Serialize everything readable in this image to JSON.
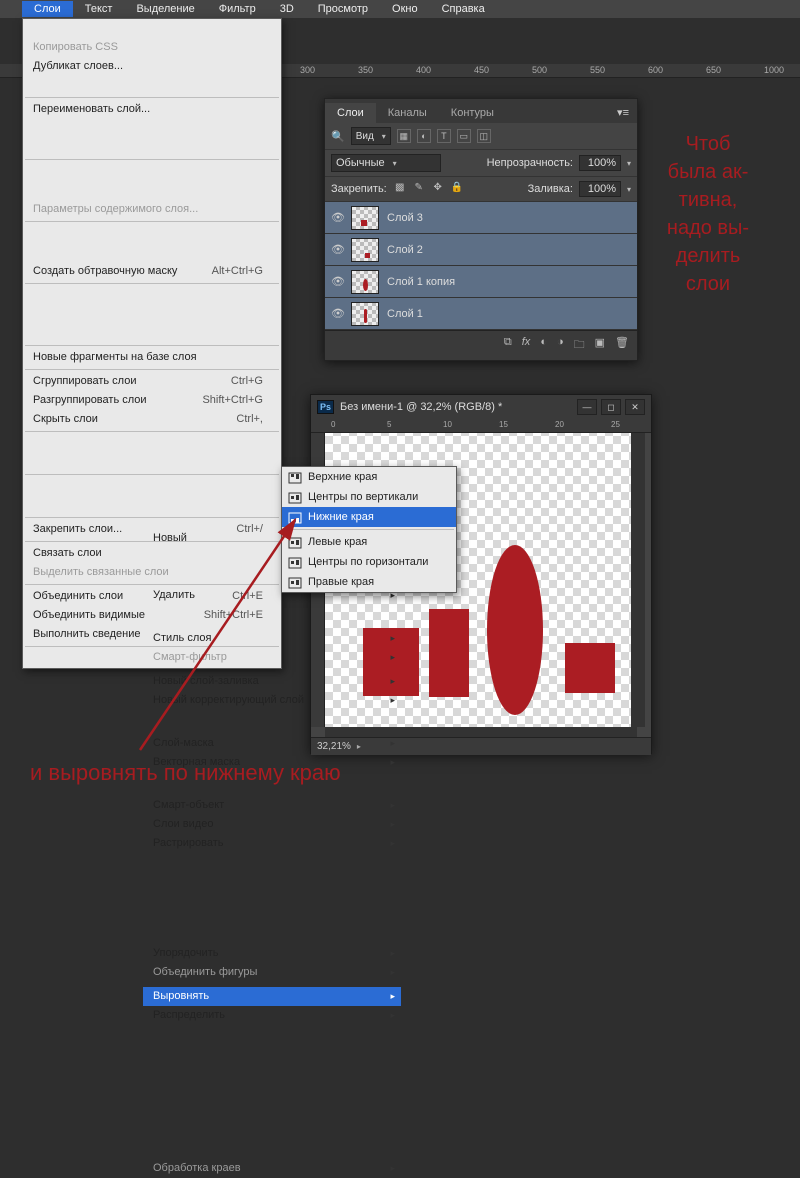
{
  "menubar": {
    "items": [
      "Слои",
      "Текст",
      "Выделение",
      "Фильтр",
      "3D",
      "Просмотр",
      "Окно",
      "Справка"
    ],
    "open_index": 0
  },
  "dropdown": [
    {
      "t": "item",
      "label": "Новый",
      "arrow": true
    },
    {
      "t": "item",
      "label": "Копировать CSS",
      "disabled": true
    },
    {
      "t": "item",
      "label": "Дубликат слоев..."
    },
    {
      "t": "item",
      "label": "Удалить",
      "arrow": true
    },
    {
      "t": "sep"
    },
    {
      "t": "item",
      "label": "Переименовать слой..."
    },
    {
      "t": "item",
      "label": "Стиль слоя",
      "arrow": true
    },
    {
      "t": "item",
      "label": "Смарт-фильтр",
      "disabled": true,
      "arrow": true
    },
    {
      "t": "sep"
    },
    {
      "t": "item",
      "label": "Новый слой-заливка",
      "arrow": true
    },
    {
      "t": "item",
      "label": "Новый корректирующий слой",
      "arrow": true
    },
    {
      "t": "item",
      "label": "Параметры содержимого слоя...",
      "disabled": true
    },
    {
      "t": "sep"
    },
    {
      "t": "item",
      "label": "Слой-маска",
      "arrow": true
    },
    {
      "t": "item",
      "label": "Векторная маска",
      "arrow": true
    },
    {
      "t": "item",
      "label": "Создать обтравочную маску",
      "shortcut": "Alt+Ctrl+G"
    },
    {
      "t": "sep"
    },
    {
      "t": "item",
      "label": "Смарт-объект",
      "arrow": true
    },
    {
      "t": "item",
      "label": "Слои видео",
      "arrow": true
    },
    {
      "t": "item",
      "label": "Растрировать",
      "arrow": true
    },
    {
      "t": "sep"
    },
    {
      "t": "item",
      "label": "Новые фрагменты на базе слоя"
    },
    {
      "t": "sep"
    },
    {
      "t": "item",
      "label": "Сгруппировать слои",
      "shortcut": "Ctrl+G"
    },
    {
      "t": "item",
      "label": "Разгруппировать слои",
      "shortcut": "Shift+Ctrl+G"
    },
    {
      "t": "item",
      "label": "Скрыть слои",
      "shortcut": "Ctrl+,"
    },
    {
      "t": "sep"
    },
    {
      "t": "item",
      "label": "Упорядочить",
      "arrow": true
    },
    {
      "t": "item",
      "label": "Объединить фигуры",
      "disabled": true,
      "arrow": true
    },
    {
      "t": "sep"
    },
    {
      "t": "item",
      "label": "Выровнять",
      "arrow": true,
      "hl": true
    },
    {
      "t": "item",
      "label": "Распределить",
      "arrow": true
    },
    {
      "t": "sep"
    },
    {
      "t": "item",
      "label": "Закрепить слои...",
      "shortcut": "Ctrl+/"
    },
    {
      "t": "sep"
    },
    {
      "t": "item",
      "label": "Связать слои"
    },
    {
      "t": "item",
      "label": "Выделить связанные слои",
      "disabled": true
    },
    {
      "t": "sep"
    },
    {
      "t": "item",
      "label": "Объединить слои",
      "shortcut": "Ctrl+E"
    },
    {
      "t": "item",
      "label": "Объединить видимые",
      "shortcut": "Shift+Ctrl+E"
    },
    {
      "t": "item",
      "label": "Выполнить сведение"
    },
    {
      "t": "sep"
    },
    {
      "t": "item",
      "label": "Обработка краев",
      "disabled": true,
      "arrow": true
    }
  ],
  "submenu": {
    "items": [
      {
        "label": "Верхние края",
        "icon": "align-top"
      },
      {
        "label": "Центры по вертикали",
        "icon": "align-vcenter"
      },
      {
        "label": "Нижние края",
        "icon": "align-bottom",
        "hl": true
      },
      {
        "t": "sep"
      },
      {
        "label": "Левые края",
        "icon": "align-left"
      },
      {
        "label": "Центры по горизонтали",
        "icon": "align-hcenter"
      },
      {
        "label": "Правые края",
        "icon": "align-right"
      }
    ]
  },
  "layers_panel": {
    "tabs": [
      "Слои",
      "Каналы",
      "Контуры"
    ],
    "active_tab": 0,
    "filter_label": "Вид",
    "blend": "Обычные",
    "opacity_label": "Непрозрачность:",
    "opacity": "100%",
    "lock_label": "Закрепить:",
    "fill_label": "Заливка:",
    "fill": "100%",
    "layers": [
      {
        "name": "Слой 3"
      },
      {
        "name": "Слой 2"
      },
      {
        "name": "Слой 1 копия"
      },
      {
        "name": "Слой 1"
      }
    ]
  },
  "document": {
    "title": "Без имени-1 @ 32,2% (RGB/8) *",
    "zoom": "32,21%",
    "ruler_marks": [
      0,
      5,
      10,
      15,
      20,
      25
    ]
  },
  "ruler_top": [
    "300",
    "350",
    "400",
    "450",
    "500",
    "550",
    "600",
    "650",
    "1000"
  ],
  "annotations": {
    "right": "Чтоб была ак-тивна, надо вы-делить слои",
    "bottom": "и выровнять по нижнему краю"
  }
}
